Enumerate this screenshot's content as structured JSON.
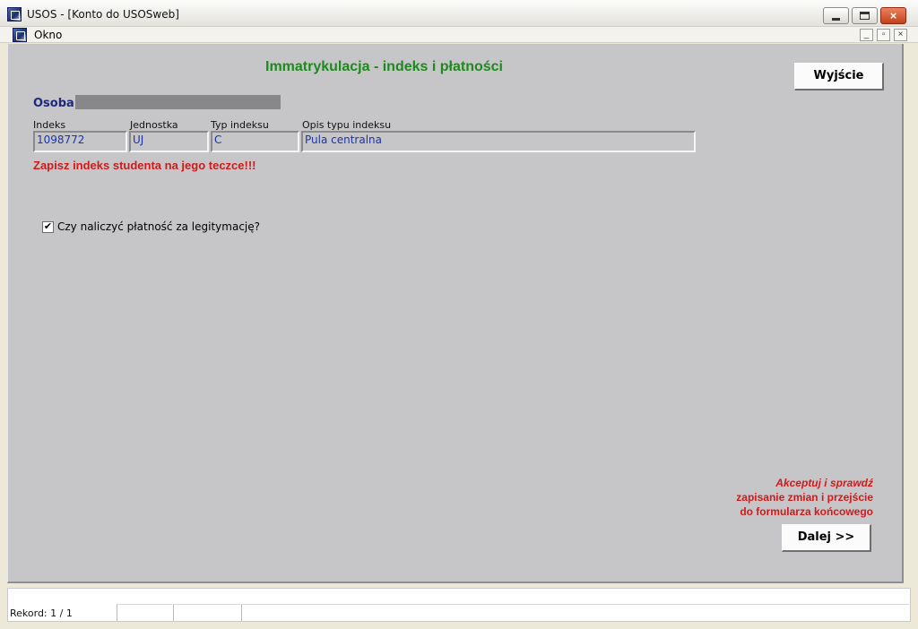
{
  "window": {
    "title": "USOS - [Konto do USOSweb]",
    "close_symbol": "×"
  },
  "menubar": {
    "items": [
      {
        "label": "Okno"
      }
    ],
    "mdi_buttons": {
      "minimize": "_",
      "restore": "▫",
      "close": "×"
    }
  },
  "form": {
    "title": "Immatrykulacja - indeks i płatności",
    "exit_button": "Wyjście",
    "osoba_label": "Osoba",
    "fields": [
      {
        "label": "Indeks",
        "value": "1098772"
      },
      {
        "label": "Jednostka",
        "value": "UJ"
      },
      {
        "label": "Typ indeksu",
        "value": "C"
      },
      {
        "label": "Opis typu indeksu",
        "value": "Pula centralna"
      }
    ],
    "warning": "Zapisz indeks studenta na jego teczce!!!",
    "checkbox": {
      "label": "Czy naliczyć płatność za legitymację?",
      "checked": true,
      "mark": "✔"
    },
    "info": {
      "line1": "Akceptuj i sprawdź",
      "line2": "zapisanie zmian i przejście",
      "line3": "do formularza końcowego"
    },
    "next_button": "Dalej >>"
  },
  "statusbar": {
    "record": "Rekord: 1 / 1"
  },
  "icons": [
    "app-icon",
    "minimize-icon",
    "maximize-icon",
    "close-icon",
    "checkmark-icon"
  ],
  "colors": {
    "form_title": "#1d8a1d",
    "warning": "#d11a1a",
    "field_text": "#1a35a8",
    "osoba_label": "#1b2a7a",
    "form_background": "#c6c5c8"
  }
}
